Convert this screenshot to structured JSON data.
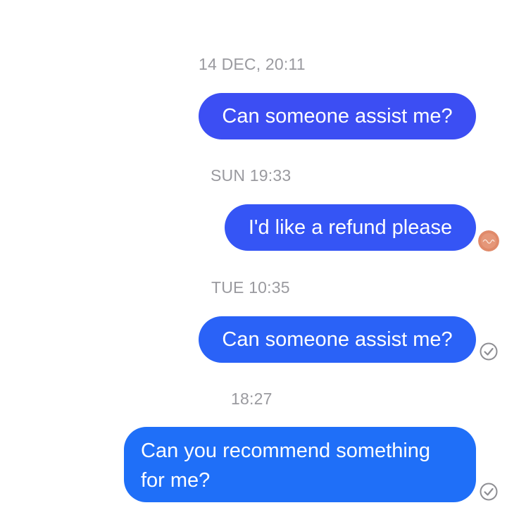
{
  "colors": {
    "bubble_1": "#3c4ef3",
    "bubble_2": "#3555f5",
    "bubble_3": "#2a62f7",
    "bubble_4": "#1f6ff8",
    "timestamp": "#9a9a9f",
    "check": "#8e8e93",
    "avatar": "#e08a6a"
  },
  "thread": [
    {
      "timestamp": "14 DEC, 20:11",
      "message": "Can someone assist me?",
      "receipt": "none"
    },
    {
      "timestamp": "SUN 19:33",
      "message": "I'd like a refund please",
      "receipt": "seen-avatar"
    },
    {
      "timestamp": "TUE 10:35",
      "message": "Can someone assist me?",
      "receipt": "delivered-check-icon"
    },
    {
      "timestamp": "18:27",
      "message": "Can you recommend something for me?",
      "receipt": "delivered-check-icon"
    }
  ]
}
